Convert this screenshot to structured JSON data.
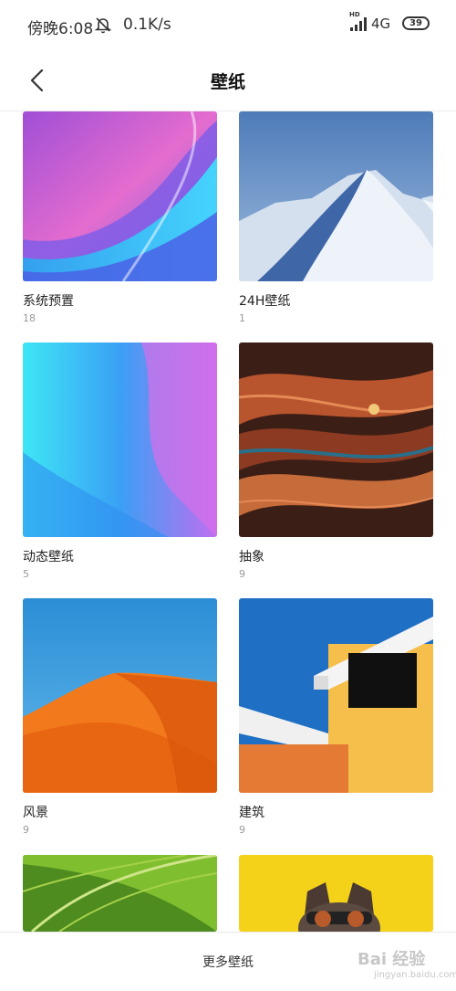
{
  "status_bar": {
    "time": "傍晚6:08",
    "speed": "0.1K/s",
    "hd": "HD",
    "network": "4G",
    "battery": "39"
  },
  "header": {
    "title": "壁纸"
  },
  "categories": [
    {
      "title": "系统预置",
      "count": "18",
      "icon": "purple-blue-curves-wallpaper"
    },
    {
      "title": "24H壁纸",
      "count": "1",
      "icon": "snow-dune-wallpaper"
    },
    {
      "title": "动态壁纸",
      "count": "5",
      "icon": "cyan-purple-gradient-wallpaper"
    },
    {
      "title": "抽象",
      "count": "9",
      "icon": "wood-grain-abstract-wallpaper"
    },
    {
      "title": "风景",
      "count": "9",
      "icon": "orange-desert-wallpaper"
    },
    {
      "title": "建筑",
      "count": "9",
      "icon": "yellow-building-wallpaper"
    },
    {
      "icon": "green-leaf-wallpaper"
    },
    {
      "icon": "dog-sunglasses-wallpaper"
    }
  ],
  "bottom": {
    "more_label": "更多壁纸"
  },
  "watermark": {
    "text": "Bai 经验",
    "sub": "jingyan.baidu.com"
  },
  "colors": {
    "background": "#ffffff",
    "count_text": "#999999"
  }
}
